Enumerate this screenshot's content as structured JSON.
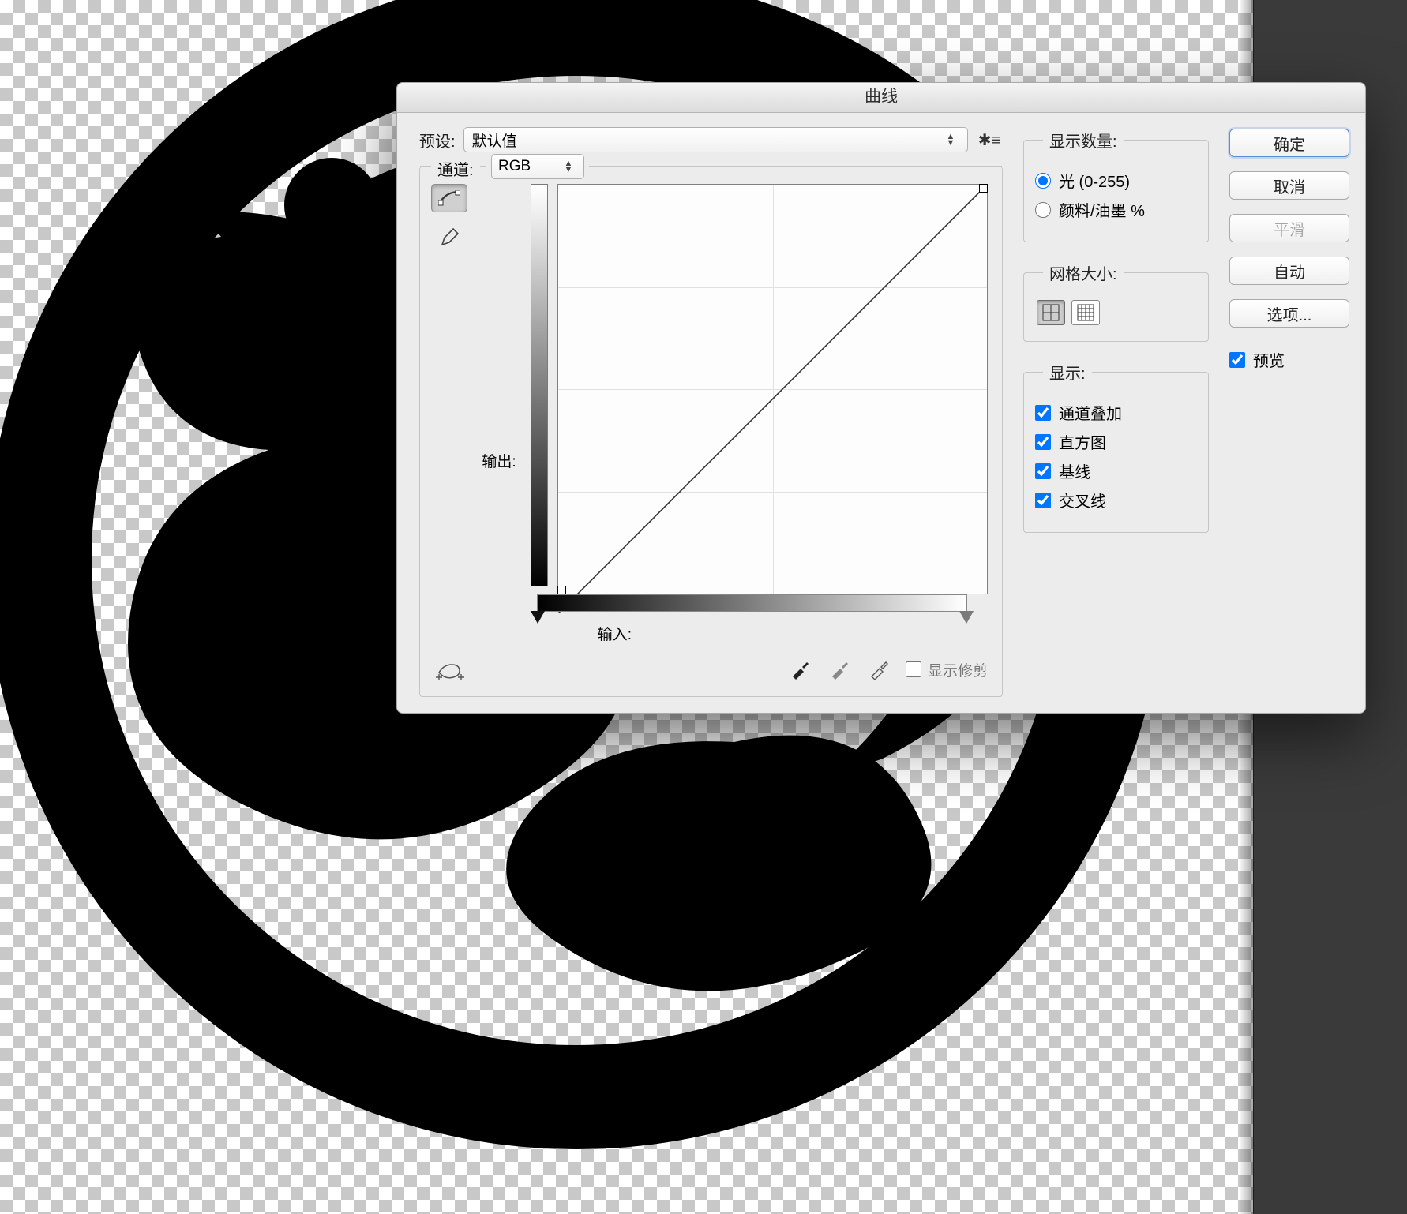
{
  "dialog": {
    "title": "曲线",
    "preset_label": "预设:",
    "preset_value": "默认值",
    "channel_label": "通道:",
    "channel_value": "RGB",
    "output_label": "输出:",
    "output_value": "",
    "input_label": "输入:",
    "input_value": "",
    "show_clipping_label": "显示修剪",
    "show_clipping_checked": false
  },
  "amount_group": {
    "legend": "显示数量:",
    "light_label": "光 (0-255)",
    "light_selected": true,
    "pigment_label": "颜料/油墨 %",
    "pigment_selected": false
  },
  "grid_group": {
    "legend": "网格大小:",
    "coarse_selected": true,
    "fine_selected": false
  },
  "show_group": {
    "legend": "显示:",
    "overlay_label": "通道叠加",
    "overlay_checked": true,
    "hist_label": "直方图",
    "hist_checked": true,
    "baseline_label": "基线",
    "baseline_checked": true,
    "intersect_label": "交叉线",
    "intersect_checked": true
  },
  "buttons": {
    "ok": "确定",
    "cancel": "取消",
    "smooth": "平滑",
    "auto": "自动",
    "options": "选项..."
  },
  "preview": {
    "label": "预览",
    "checked": true
  },
  "chart_data": {
    "type": "line",
    "title": "",
    "xlabel": "输入",
    "ylabel": "输出",
    "xlim": [
      0,
      255
    ],
    "ylim": [
      0,
      255
    ],
    "series": [
      {
        "name": "RGB",
        "x": [
          0,
          255
        ],
        "y": [
          0,
          255
        ]
      }
    ],
    "grid_divisions": 4
  }
}
